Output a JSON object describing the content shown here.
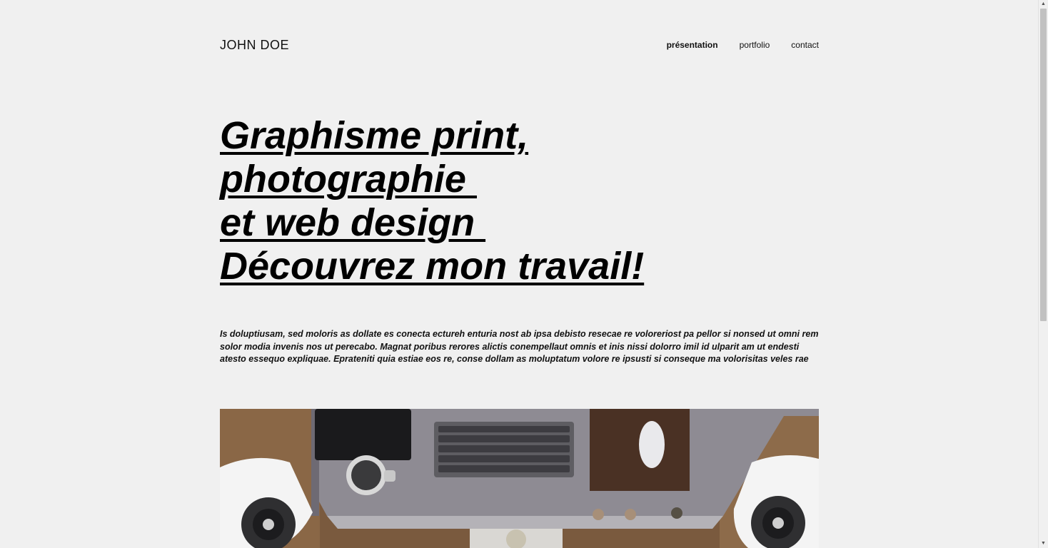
{
  "header": {
    "brand": "JOHN DOE",
    "nav": [
      {
        "label": "présentation",
        "active": true
      },
      {
        "label": "portfolio",
        "active": false
      },
      {
        "label": "contact",
        "active": false
      }
    ]
  },
  "hero": {
    "lines": [
      "Graphisme print,",
      "photographie ",
      "et web design ",
      "Découvrez mon travail!"
    ]
  },
  "intro": {
    "text": "Is doluptiusam, sed moloris as dollate es conecta ectureh enturia nost ab ipsa debisto resecae re voloreriost pa pellor si nonsed ut omni rem solor modia invenis nos ut perecabo. Magnat poribus rerores alictis conempellaut omnis et inis nissi dolorro imil id ulparit am ut endesti atesto essequo expliquae. Eprateniti quia estiae eos re, conse dollam as moluptatum volore re ipsusti si conseque ma volorisitas veles rae"
  },
  "image": {
    "subject": "desk-workspace-photo"
  },
  "scrollbar": {
    "up_icon": "arrow-up-icon",
    "down_icon": "arrow-down-icon"
  }
}
